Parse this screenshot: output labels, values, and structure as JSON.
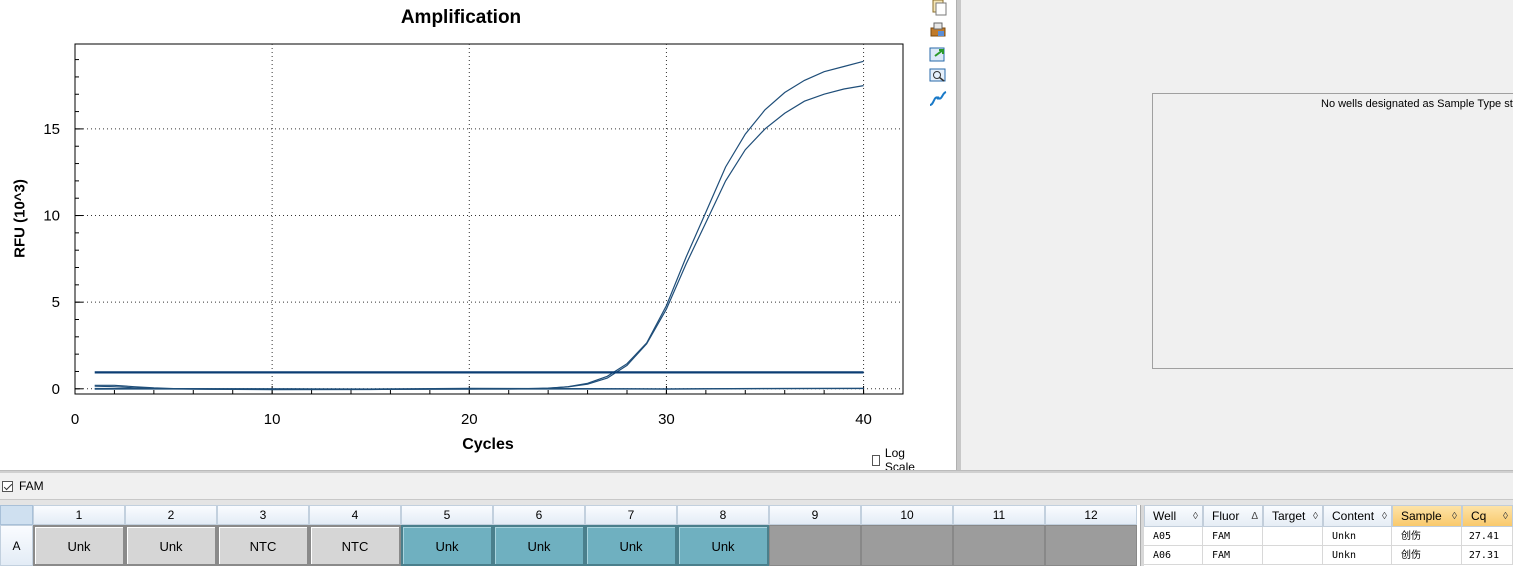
{
  "chart_data": {
    "type": "line",
    "title": "Amplification",
    "xlabel": "Cycles",
    "ylabel": "RFU (10^3)",
    "xlim": [
      0,
      42
    ],
    "ylim": [
      -0.3,
      19.9
    ],
    "xticks": [
      0,
      10,
      20,
      30,
      40
    ],
    "yticks": [
      0,
      5,
      10,
      15
    ],
    "grid": true,
    "legend": "none",
    "threshold": 0.95,
    "series_color": "#1f4e79",
    "threshold_color": "#0b3d73",
    "series": [
      {
        "x": [
          1,
          2,
          3,
          4,
          5,
          6,
          7,
          8,
          9,
          10,
          11,
          12,
          13,
          14,
          15,
          16,
          17,
          18,
          19,
          20,
          21,
          22,
          23,
          24,
          25,
          26,
          27,
          28,
          29,
          30,
          31,
          32,
          33,
          34,
          35,
          36,
          37,
          38,
          39,
          40
        ],
        "values": [
          0.15,
          0.12,
          0.06,
          0.02,
          0.0,
          -0.01,
          -0.02,
          -0.02,
          -0.02,
          -0.01,
          -0.01,
          -0.02,
          -0.02,
          -0.02,
          -0.02,
          -0.02,
          -0.02,
          -0.01,
          -0.01,
          -0.01,
          -0.01,
          -0.01,
          0.0,
          0.03,
          0.12,
          0.32,
          0.72,
          1.45,
          2.65,
          4.8,
          7.6,
          10.2,
          12.8,
          14.7,
          16.1,
          17.1,
          17.8,
          18.3,
          18.6,
          18.9
        ]
      },
      {
        "x": [
          1,
          2,
          3,
          4,
          5,
          6,
          7,
          8,
          9,
          10,
          11,
          12,
          13,
          14,
          15,
          16,
          17,
          18,
          19,
          20,
          21,
          22,
          23,
          24,
          25,
          26,
          27,
          28,
          29,
          30,
          31,
          32,
          33,
          34,
          35,
          36,
          37,
          38,
          39,
          40
        ],
        "values": [
          0.2,
          0.2,
          0.12,
          0.05,
          0.01,
          0.0,
          -0.01,
          -0.01,
          -0.01,
          -0.01,
          -0.01,
          -0.01,
          -0.01,
          -0.01,
          -0.01,
          -0.01,
          -0.01,
          -0.01,
          -0.01,
          -0.01,
          0.0,
          0.0,
          0.01,
          0.04,
          0.11,
          0.27,
          0.62,
          1.35,
          2.6,
          4.6,
          7.2,
          9.6,
          12.0,
          13.8,
          15.0,
          15.9,
          16.6,
          17.0,
          17.3,
          17.5
        ]
      },
      {
        "x": [
          1,
          5,
          10,
          15,
          20,
          25,
          30,
          35,
          40
        ],
        "values": [
          0.02,
          0.01,
          0.0,
          -0.02,
          0.03,
          0.01,
          0.0,
          0.02,
          0.03
        ]
      },
      {
        "x": [
          1,
          5,
          10,
          15,
          20,
          25,
          30,
          35,
          40
        ],
        "values": [
          -0.02,
          -0.01,
          -0.05,
          -0.04,
          -0.01,
          -0.01,
          -0.02,
          0.01,
          0.02
        ]
      }
    ]
  },
  "log_scale_label": "Log Scale",
  "right_panel": {
    "message": "No wells designated as Sample Type standard"
  },
  "fluor_checkbox": {
    "label": "FAM"
  },
  "plate": {
    "columns": [
      "1",
      "2",
      "3",
      "4",
      "5",
      "6",
      "7",
      "8",
      "9",
      "10",
      "11",
      "12"
    ],
    "row_label": "A",
    "wells": [
      "Unk",
      "Unk",
      "NTC",
      "NTC",
      "Unk",
      "Unk",
      "Unk",
      "Unk",
      "",
      "",
      "",
      ""
    ]
  },
  "table": {
    "headers": [
      "Well",
      "Fluor",
      "Target",
      "Content",
      "Sample",
      "Cq"
    ],
    "rows": [
      [
        "A05",
        "FAM",
        "",
        "Unkn",
        "创伤",
        "27.41"
      ],
      [
        "A06",
        "FAM",
        "",
        "Unkn",
        "创伤",
        "27.31"
      ]
    ]
  }
}
